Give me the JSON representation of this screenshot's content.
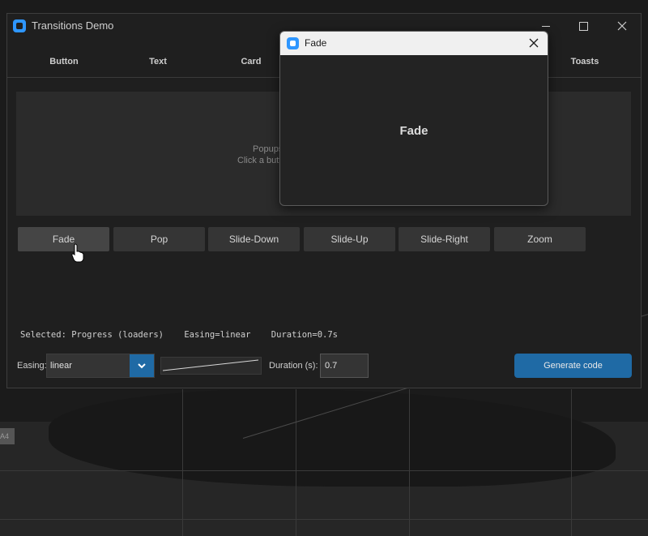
{
  "window": {
    "title": "Transitions Demo"
  },
  "tabs": [
    "Button",
    "Text",
    "Card",
    "",
    "",
    "",
    "Toasts"
  ],
  "preview": {
    "hint_line1": "Popups",
    "hint_line2": "Click a butt"
  },
  "transition_buttons": [
    "Fade",
    "Pop",
    "Slide-Down",
    "Slide-Up",
    "Slide-Right",
    "Zoom"
  ],
  "status": {
    "selected": "Selected: Progress (loaders)",
    "easing": "Easing=linear",
    "duration": "Duration=0.7s"
  },
  "controls": {
    "easing_label": "Easing:",
    "easing_value": "linear",
    "duration_label": "Duration (s):",
    "duration_value": "0.7",
    "generate_label": "Generate code"
  },
  "popup": {
    "title": "Fade",
    "body": "Fade"
  },
  "desktop": {
    "tag": "A4"
  },
  "colors": {
    "accent": "#1f6aa5",
    "app_icon": "#2e96ff"
  },
  "icons": {
    "app": "app-icon",
    "minimize": "minimize-icon",
    "maximize": "maximize-icon",
    "close": "close-icon",
    "dropdown": "chevron-down-icon",
    "cursor": "hand-pointer-icon"
  }
}
